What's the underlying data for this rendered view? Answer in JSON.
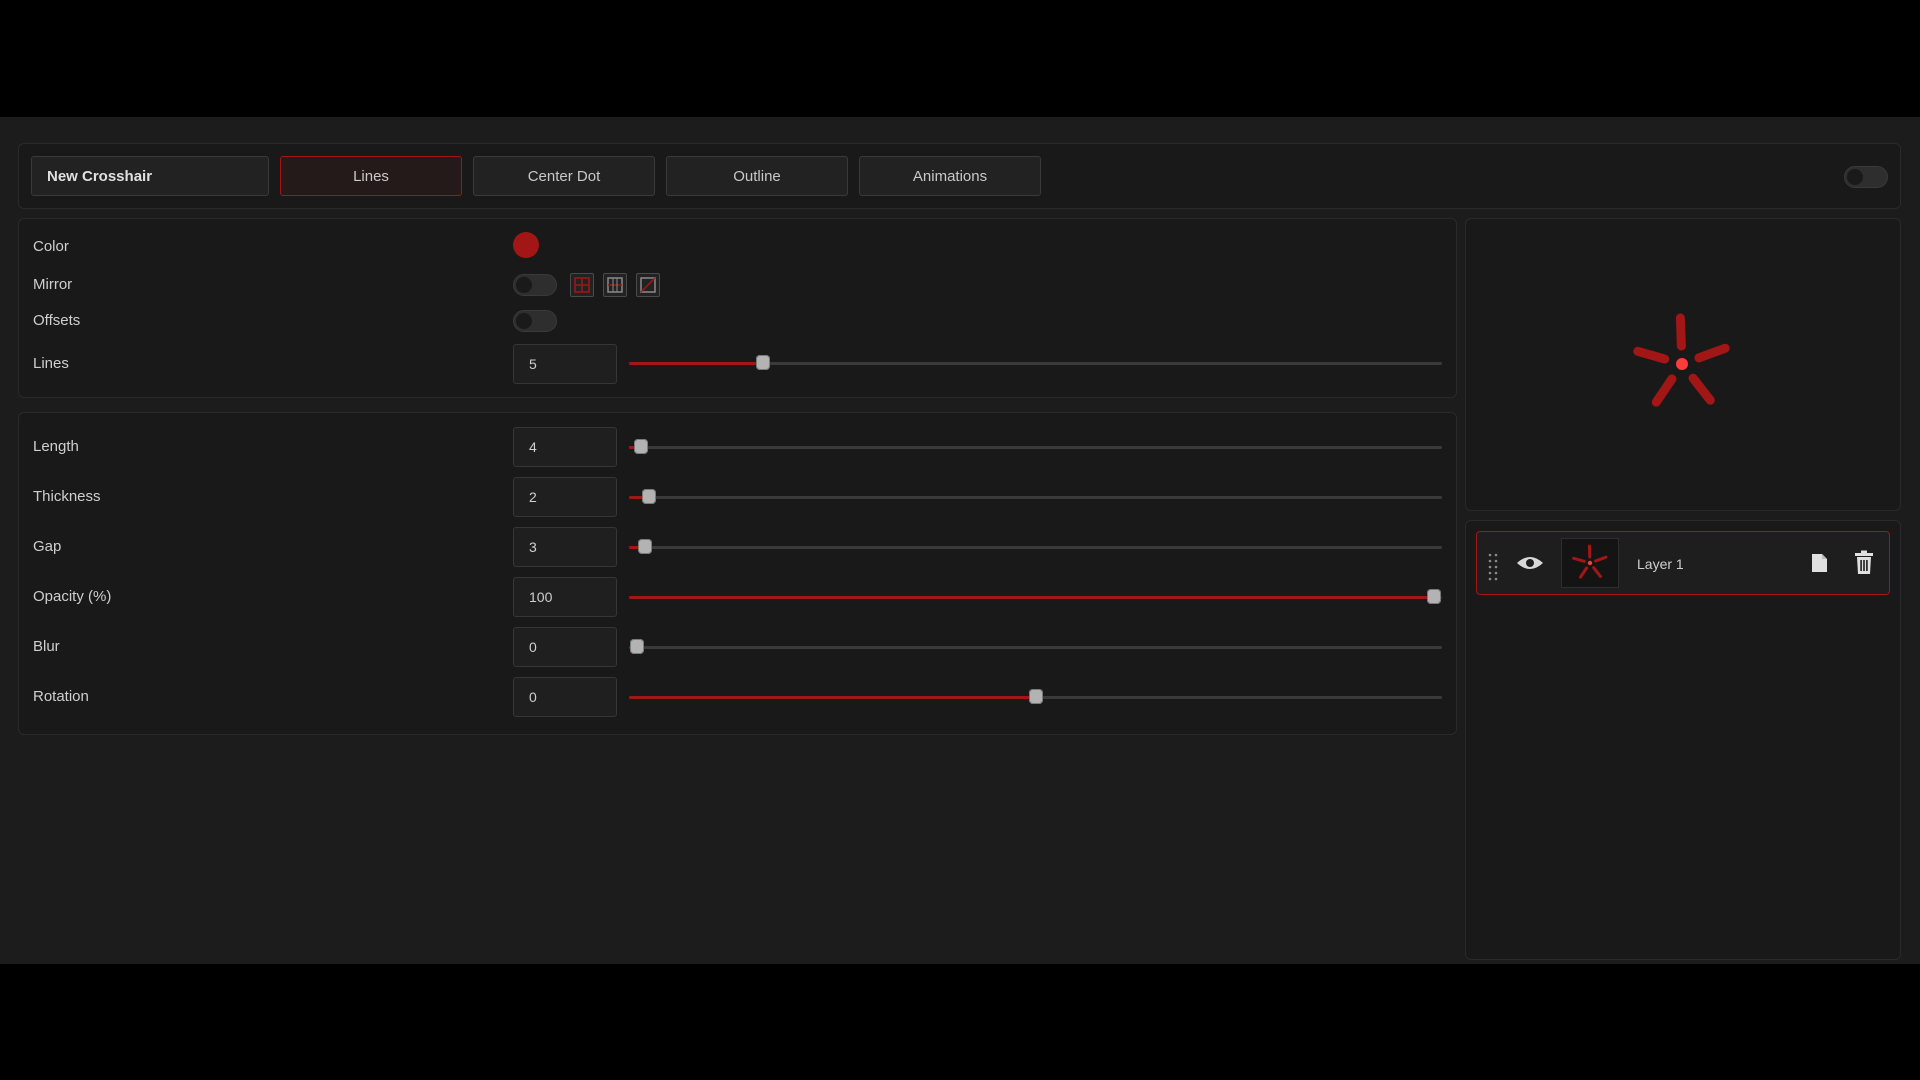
{
  "header": {
    "crosshair_name": "New Crosshair",
    "tabs": [
      {
        "label": "Lines",
        "active": true
      },
      {
        "label": "Center Dot",
        "active": false
      },
      {
        "label": "Outline",
        "active": false
      },
      {
        "label": "Animations",
        "active": false
      }
    ],
    "master_toggle": false
  },
  "lines_panel": {
    "color": {
      "label": "Color",
      "value": "#a31616"
    },
    "mirror": {
      "label": "Mirror",
      "enabled": false,
      "modes": [
        "mirror-quad-icon",
        "mirror-horizontal-icon",
        "mirror-diagonal-icon"
      ]
    },
    "offsets": {
      "label": "Offsets",
      "enabled": false
    },
    "lines": {
      "label": "Lines",
      "value": "5",
      "fraction": 0.165
    }
  },
  "params_panel": {
    "rows": [
      {
        "key": "length",
        "label": "Length",
        "value": "4",
        "fraction": 0.015
      },
      {
        "key": "thickness",
        "label": "Thickness",
        "value": "2",
        "fraction": 0.024
      },
      {
        "key": "gap",
        "label": "Gap",
        "value": "3",
        "fraction": 0.02
      },
      {
        "key": "opacity",
        "label": "Opacity (%)",
        "value": "100",
        "fraction": 0.99
      },
      {
        "key": "blur",
        "label": "Blur",
        "value": "0",
        "fraction": 0.01
      },
      {
        "key": "rotation",
        "label": "Rotation",
        "value": "0",
        "fraction": 0.5
      }
    ]
  },
  "preview": {
    "accent": "#a31616",
    "center_dot_color": "#ff3b3b"
  },
  "layers": [
    {
      "name": "Layer 1",
      "visible": true,
      "selected": true
    }
  ],
  "colors": {
    "accent": "#a31616",
    "background": "#1c1c1c",
    "panel": "#191919"
  }
}
